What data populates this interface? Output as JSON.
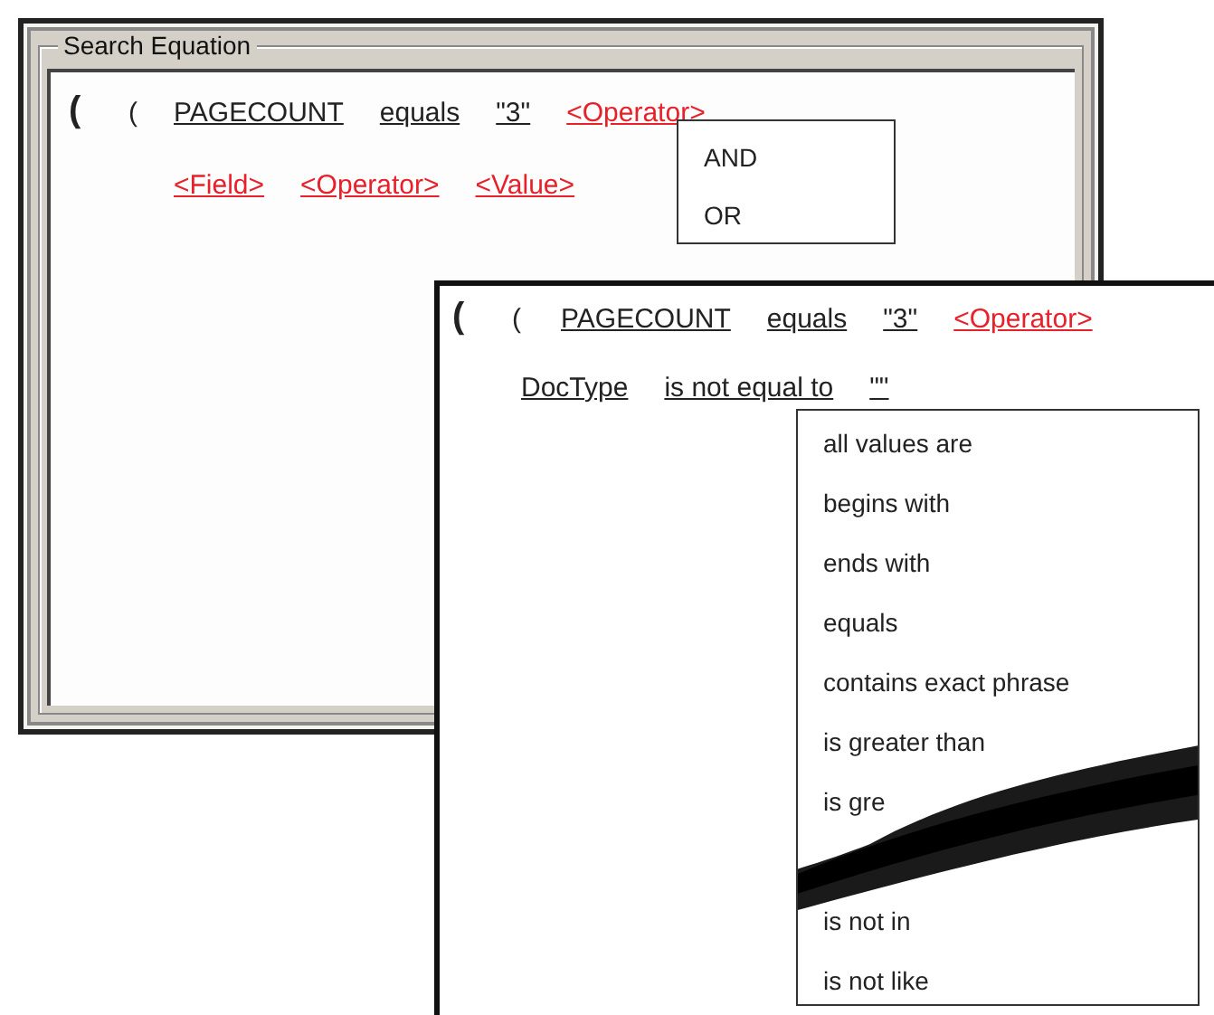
{
  "back_window": {
    "group_title": "Search Equation",
    "rows": [
      {
        "kind": "group",
        "tokens": [
          {
            "kind": "big-paren",
            "text": "("
          },
          {
            "kind": "paren",
            "text": "("
          },
          {
            "kind": "term",
            "text": "PAGECOUNT"
          },
          {
            "kind": "term",
            "text": "equals"
          },
          {
            "kind": "term",
            "text": "\"3\""
          },
          {
            "kind": "placeholder",
            "text": "<Operator>"
          }
        ]
      },
      {
        "kind": "condition",
        "tokens": [
          {
            "kind": "placeholder",
            "text": "<Field>"
          },
          {
            "kind": "placeholder",
            "text": "<Operator>"
          },
          {
            "kind": "placeholder",
            "text": "<Value>"
          }
        ]
      }
    ],
    "menu": {
      "items": [
        "AND",
        "OR"
      ]
    }
  },
  "front_window": {
    "rows": [
      {
        "kind": "group",
        "tokens": [
          {
            "kind": "big-paren",
            "text": "("
          },
          {
            "kind": "paren",
            "text": "("
          },
          {
            "kind": "term",
            "text": "PAGECOUNT"
          },
          {
            "kind": "term",
            "text": "equals"
          },
          {
            "kind": "term",
            "text": "\"3\""
          },
          {
            "kind": "placeholder",
            "text": "<Operator>"
          }
        ]
      },
      {
        "kind": "condition",
        "tokens": [
          {
            "kind": "term",
            "text": "DocType"
          },
          {
            "kind": "term",
            "text": "is not equal to"
          },
          {
            "kind": "term",
            "text": "\"\""
          }
        ]
      }
    ],
    "dropdown": {
      "items": [
        "all values are",
        "begins with",
        "ends with",
        "equals",
        "contains exact phrase",
        "is greater than",
        "is gre",
        "is not in",
        "is not like"
      ]
    }
  }
}
